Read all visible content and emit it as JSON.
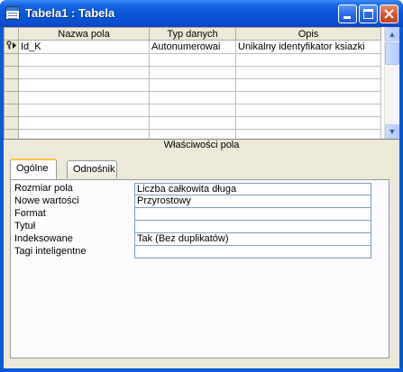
{
  "window": {
    "title": "Tabela1 : Tabela",
    "icons": [
      "table-app-icon",
      "minimize-icon",
      "maximize-icon",
      "close-icon"
    ]
  },
  "grid": {
    "columns": [
      "Nazwa pola",
      "Typ danych",
      "Opis"
    ],
    "rows": [
      {
        "name": "Id_K",
        "type": "Autonumerowai",
        "desc": "Unikalny identyfikator ksiazki",
        "key": true
      },
      {
        "name": "",
        "type": "",
        "desc": ""
      },
      {
        "name": "",
        "type": "",
        "desc": ""
      },
      {
        "name": "",
        "type": "",
        "desc": ""
      },
      {
        "name": "",
        "type": "",
        "desc": ""
      },
      {
        "name": "",
        "type": "",
        "desc": ""
      },
      {
        "name": "",
        "type": "",
        "desc": ""
      },
      {
        "name": "",
        "type": "",
        "desc": ""
      }
    ],
    "selector_icon": "primary-key-arrow-icon"
  },
  "properties": {
    "section_label": "Właściwości pola",
    "tabs": [
      {
        "label": "Ogólne",
        "active": true
      },
      {
        "label": "Odnośnik",
        "active": false
      }
    ],
    "rows": [
      {
        "label": "Rozmiar pola",
        "value": "Liczba całkowita długa"
      },
      {
        "label": "Nowe wartości",
        "value": "Przyrostowy"
      },
      {
        "label": "Format",
        "value": ""
      },
      {
        "label": "Tytuł",
        "value": ""
      },
      {
        "label": "Indeksowane",
        "value": "Tak (Bez duplikatów)"
      },
      {
        "label": "Tagi inteligentne",
        "value": ""
      }
    ]
  },
  "colors": {
    "titlebar": "#0a54d8",
    "close_button": "#d5582f",
    "face": "#ece9d8",
    "active_tab_highlight": "#ffc83c"
  }
}
